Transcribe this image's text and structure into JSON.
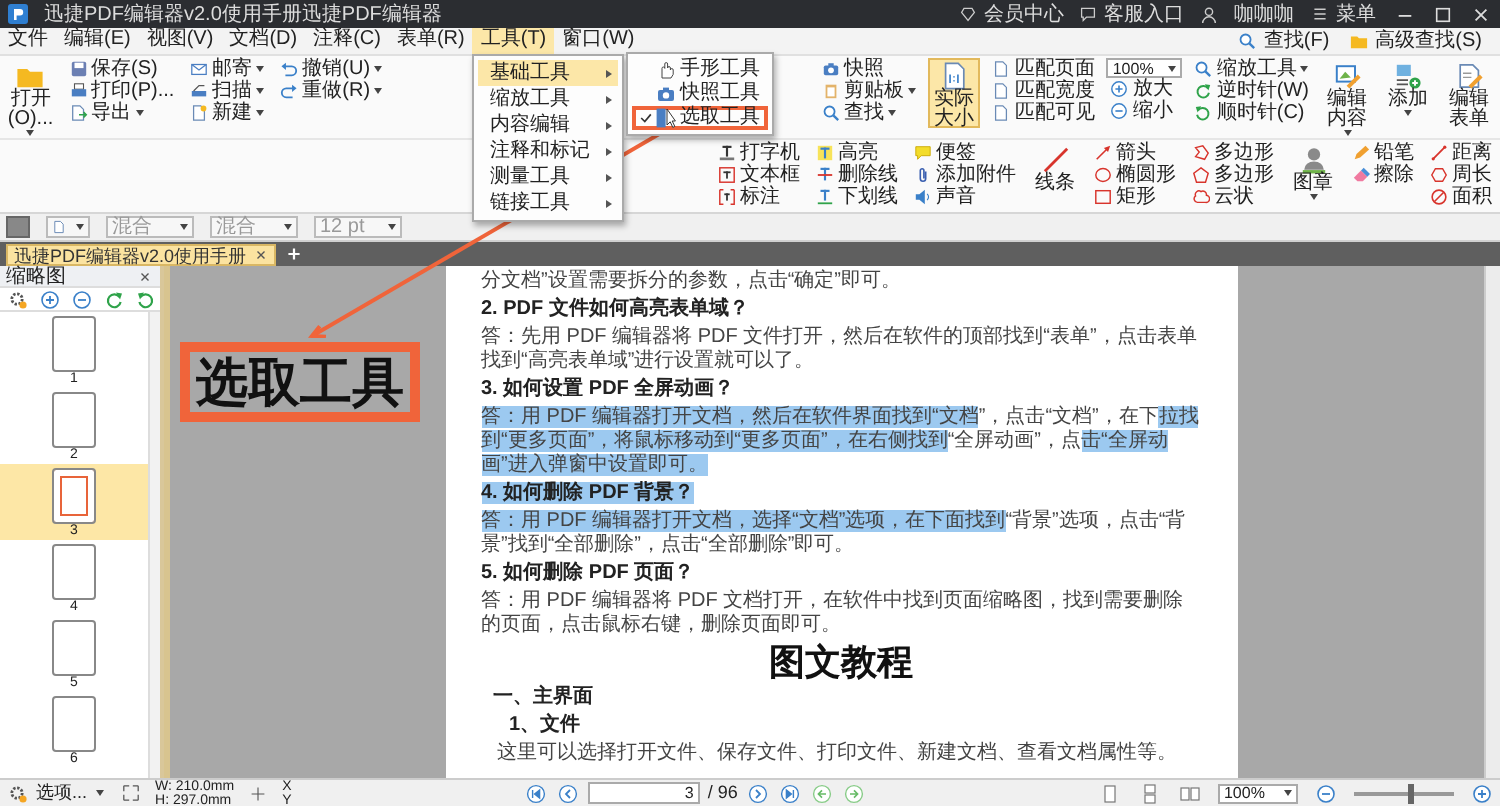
{
  "title_bar": {
    "title": "迅捷PDF编辑器v2.0使用手册迅捷PDF编辑器",
    "links": [
      "会员中心",
      "客服入口"
    ],
    "user": "咖咖咖",
    "menu": "菜单"
  },
  "menu_bar": {
    "items": [
      {
        "label": "文件",
        "selected": false
      },
      {
        "label": "编辑(E)",
        "selected": false
      },
      {
        "label": "视图(V)",
        "selected": false
      },
      {
        "label": "文档(D)",
        "selected": false
      },
      {
        "label": "注释(C)",
        "selected": false
      },
      {
        "label": "表单(R)",
        "selected": false
      },
      {
        "label": "工具(T)",
        "selected": true
      },
      {
        "label": "窗口(W)",
        "selected": false
      }
    ],
    "search": [
      "查找(F)",
      "高级查找(S)"
    ]
  },
  "ribbon": {
    "columns": [
      {
        "kind": "large",
        "label": "打开(O)...",
        "dropdown": true,
        "selected": false
      },
      {
        "kind": "stack",
        "items": [
          {
            "kind": "button",
            "label": "保存(S)",
            "dropdown": false
          },
          {
            "kind": "button",
            "label": "打印(P)...",
            "dropdown": false
          },
          {
            "kind": "button",
            "label": "导出",
            "dropdown": true
          }
        ]
      },
      {
        "kind": "stack",
        "items": [
          {
            "kind": "button",
            "label": "邮寄",
            "dropdown": true
          },
          {
            "kind": "button",
            "label": "扫描",
            "dropdown": true
          },
          {
            "kind": "button",
            "label": "新建",
            "dropdown": true
          }
        ]
      },
      {
        "kind": "stack",
        "items": [
          {
            "kind": "button",
            "label": "撤销(U)",
            "dropdown": true
          },
          {
            "kind": "button",
            "label": "重做(R)",
            "dropdown": true
          }
        ]
      },
      {
        "kind": "stack",
        "items": [
          {
            "kind": "button",
            "label": "快照",
            "dropdown": false
          },
          {
            "kind": "button",
            "label": "剪贴板",
            "dropdown": true
          },
          {
            "kind": "button",
            "label": "查找",
            "dropdown": true
          }
        ]
      },
      {
        "kind": "large",
        "label": "实际大小",
        "dropdown": false,
        "selected": true
      },
      {
        "kind": "stack",
        "items": [
          {
            "kind": "button",
            "label": "匹配页面",
            "dropdown": false
          },
          {
            "kind": "button",
            "label": "匹配宽度",
            "dropdown": false
          },
          {
            "kind": "button",
            "label": "匹配可见",
            "dropdown": false
          }
        ]
      },
      {
        "kind": "stack",
        "items": [
          {
            "kind": "select",
            "label": "100%",
            "dropdown": true
          },
          {
            "kind": "button",
            "label": "放大",
            "dropdown": false
          },
          {
            "kind": "button",
            "label": "缩小",
            "dropdown": false
          }
        ]
      },
      {
        "kind": "stack",
        "items": [
          {
            "kind": "button",
            "label": "缩放工具",
            "dropdown": true
          },
          {
            "kind": "button",
            "label": "逆时针(W)",
            "dropdown": false
          },
          {
            "kind": "button",
            "label": "顺时针(C)",
            "dropdown": false
          }
        ]
      },
      {
        "kind": "large",
        "label": "编辑内容",
        "dropdown": true,
        "selected": false
      },
      {
        "kind": "large",
        "label": "添加",
        "dropdown": true,
        "selected": false
      },
      {
        "kind": "large",
        "label": "编辑表单",
        "dropdown": false,
        "selected": false
      },
      {
        "kind": "stack",
        "items": [
          {
            "kind": "button",
            "label": "打字机",
            "dropdown": false
          },
          {
            "kind": "button",
            "label": "文本框",
            "dropdown": false
          },
          {
            "kind": "button",
            "label": "标注",
            "dropdown": false
          }
        ]
      },
      {
        "kind": "stack",
        "items": [
          {
            "kind": "button",
            "label": "高亮",
            "dropdown": false
          },
          {
            "kind": "button",
            "label": "删除线",
            "dropdown": false
          },
          {
            "kind": "button",
            "label": "下划线",
            "dropdown": false
          }
        ]
      },
      {
        "kind": "stack",
        "items": [
          {
            "kind": "button",
            "label": "便签",
            "dropdown": false
          },
          {
            "kind": "button",
            "label": "添加附件",
            "dropdown": false
          },
          {
            "kind": "button",
            "label": "声音",
            "dropdown": false
          }
        ]
      },
      {
        "kind": "large",
        "label": "线条",
        "dropdown": false,
        "selected": false
      },
      {
        "kind": "stack",
        "items": [
          {
            "kind": "button",
            "label": "箭头",
            "dropdown": false
          },
          {
            "kind": "button",
            "label": "椭圆形",
            "dropdown": false
          },
          {
            "kind": "button",
            "label": "矩形",
            "dropdown": false
          }
        ]
      },
      {
        "kind": "stack",
        "items": [
          {
            "kind": "button",
            "label": "多边形",
            "dropdown": false
          },
          {
            "kind": "button",
            "label": "多边形",
            "dropdown": false
          },
          {
            "kind": "button",
            "label": "云状",
            "dropdown": false
          }
        ]
      },
      {
        "kind": "large",
        "label": "图章",
        "dropdown": true,
        "selected": false
      },
      {
        "kind": "stack",
        "items": [
          {
            "kind": "button",
            "label": "铅笔",
            "dropdown": false
          },
          {
            "kind": "button",
            "label": "擦除",
            "dropdown": false
          }
        ]
      },
      {
        "kind": "stack",
        "items": [
          {
            "kind": "button",
            "label": "距离",
            "dropdown": false
          },
          {
            "kind": "button",
            "label": "周长",
            "dropdown": false
          },
          {
            "kind": "button",
            "label": "面积",
            "dropdown": false
          }
        ]
      }
    ]
  },
  "format_bar": {
    "fields": [
      {
        "kind": "color"
      },
      {
        "kind": "blank"
      },
      {
        "kind": "select",
        "value": "混合"
      },
      {
        "kind": "select",
        "value": "混合"
      },
      {
        "kind": "select",
        "value": "12 pt"
      }
    ]
  },
  "tools_menu": {
    "items": [
      {
        "label": "基础工具",
        "selected": true
      },
      {
        "label": "缩放工具",
        "selected": false
      },
      {
        "label": "内容编辑",
        "selected": false
      },
      {
        "label": "注释和标记",
        "selected": false
      },
      {
        "label": "测量工具",
        "selected": false
      },
      {
        "label": "链接工具",
        "selected": false
      }
    ],
    "submenu": [
      {
        "label": "手形工具",
        "checked": false,
        "highlighted": false
      },
      {
        "label": "快照工具",
        "checked": false,
        "highlighted": false
      },
      {
        "label": "选取工具",
        "checked": true,
        "highlighted": true
      }
    ]
  },
  "tabs": [
    {
      "label": "迅捷PDF编辑器v2.0使用手册",
      "selected": true
    }
  ],
  "sidebar": {
    "title": "缩略图",
    "thumbnails": [
      {
        "label": "1",
        "selected": false
      },
      {
        "label": "2",
        "selected": false
      },
      {
        "label": "3",
        "selected": true
      },
      {
        "label": "4",
        "selected": false
      },
      {
        "label": "5",
        "selected": false
      },
      {
        "label": "6",
        "selected": false
      }
    ]
  },
  "callout": {
    "label": "选取工具"
  },
  "document": {
    "blocks": [
      {
        "kind": "para",
        "parts": [
          {
            "text": "分文档”设置需要拆分的参数，点击“确定”即可。",
            "selected": false
          }
        ]
      },
      {
        "kind": "question",
        "parts": [
          {
            "text": "2. PDF 文件如何高亮表单域？",
            "selected": false
          }
        ]
      },
      {
        "kind": "para",
        "parts": [
          {
            "text": "答：先用 PDF 编辑器将 PDF 文件打开，然后在软件的顶部找到“表单”，点击表单找到“高亮表单域”进行设置就可以了。",
            "selected": false
          }
        ]
      },
      {
        "kind": "question",
        "parts": [
          {
            "text": "3. 如何设置 PDF 全屏动画？",
            "selected": false
          }
        ]
      },
      {
        "kind": "para",
        "parts": [
          {
            "text": "答：用 PDF 编辑器打开文档，然后在软件界面找到“文档",
            "selected": true
          },
          {
            "text": "”，点击“文档”，在下",
            "selected": false
          },
          {
            "text": "拉找到“更多页面”，将鼠标移动到“更多页面”，在右侧找到",
            "selected": true
          },
          {
            "text": "“全屏动画”，点",
            "selected": false
          },
          {
            "text": "击“全屏动画”进入弹窗中设置即可。",
            "selected": true
          }
        ]
      },
      {
        "kind": "question",
        "parts": [
          {
            "text": "4. 如何删除 PDF 背景？",
            "selected": true
          }
        ]
      },
      {
        "kind": "para",
        "parts": [
          {
            "text": "答：用 PDF 编辑器打开文档，选择“文档”选项，在下面找到",
            "selected": true
          },
          {
            "text": "“背景”选项，点击“背景”找到“全部删除”，点击“全部删除”即可。",
            "selected": false
          }
        ]
      },
      {
        "kind": "question",
        "parts": [
          {
            "text": "5. 如何删除 PDF 页面？",
            "selected": false
          }
        ]
      },
      {
        "kind": "para",
        "parts": [
          {
            "text": "答：用 PDF 编辑器将 PDF 文档打开，在软件中找到页面缩略图，找到需要删除的页面，点击鼠标右键，删除页面即可。",
            "selected": false
          }
        ]
      },
      {
        "kind": "title",
        "parts": [
          {
            "text": "图文教程",
            "selected": false
          }
        ]
      },
      {
        "kind": "section",
        "parts": [
          {
            "text": "一、主界面",
            "selected": false
          }
        ]
      },
      {
        "kind": "subsection",
        "parts": [
          {
            "text": "1、文件",
            "selected": false
          }
        ]
      },
      {
        "kind": "note",
        "parts": [
          {
            "text": "这里可以选择打开文件、保存文件、打印文件、新建文档、查看文档属性等。",
            "selected": false
          }
        ]
      }
    ]
  },
  "status_bar": {
    "options": "选项...",
    "width": "W: 210.0mm",
    "height": "H: 297.0mm",
    "x": "X",
    "y": "Y",
    "page": "3",
    "page_total": "/ 96",
    "zoom": "100%",
    "zoom_slider": {
      "level": 0.55
    }
  }
}
